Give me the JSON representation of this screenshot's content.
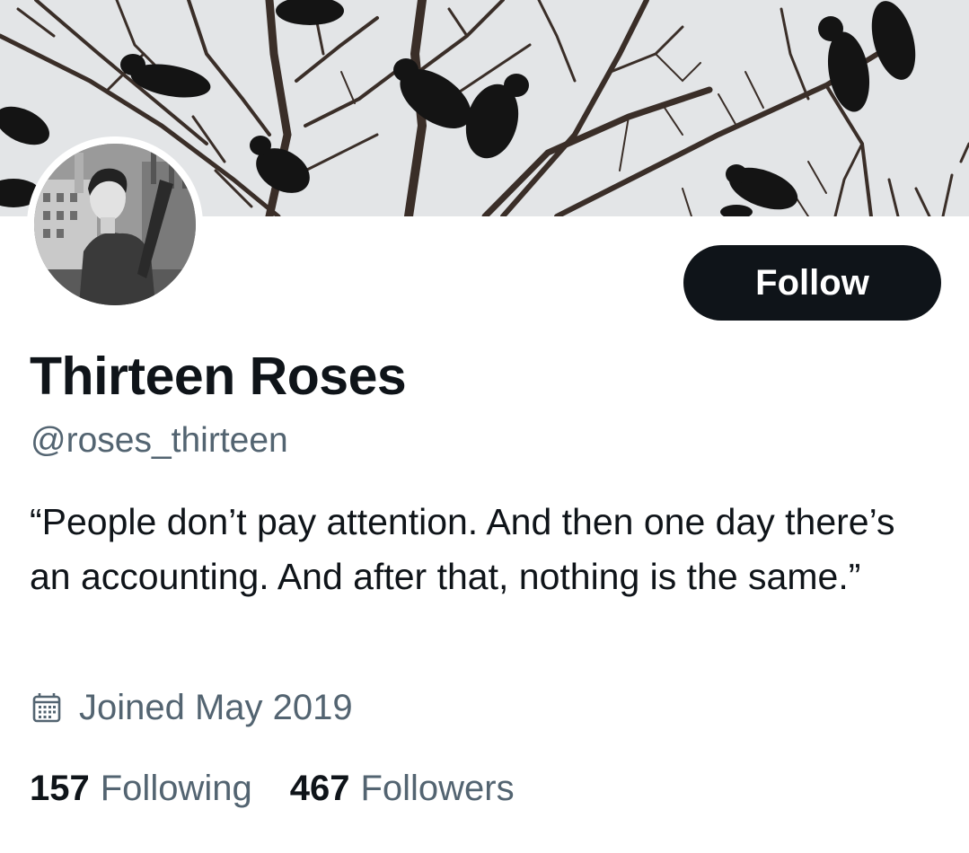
{
  "profile": {
    "display_name": "Thirteen Roses",
    "handle": "@roses_thirteen",
    "bio": "“People don’t pay attention.  And then one day there’s an accounting.  And after that, nothing is the same.”",
    "joined": "Joined May 2019"
  },
  "actions": {
    "follow_label": "Follow"
  },
  "stats": {
    "following": {
      "count": "157",
      "label": "Following"
    },
    "followers": {
      "count": "467",
      "label": "Followers"
    }
  },
  "icons": {
    "joined": "calendar-icon"
  },
  "colors": {
    "text_primary": "#0f1419",
    "text_secondary": "#536471",
    "button_bg": "#0f1419",
    "button_text": "#ffffff",
    "banner_sky": "#e4e6e8"
  }
}
